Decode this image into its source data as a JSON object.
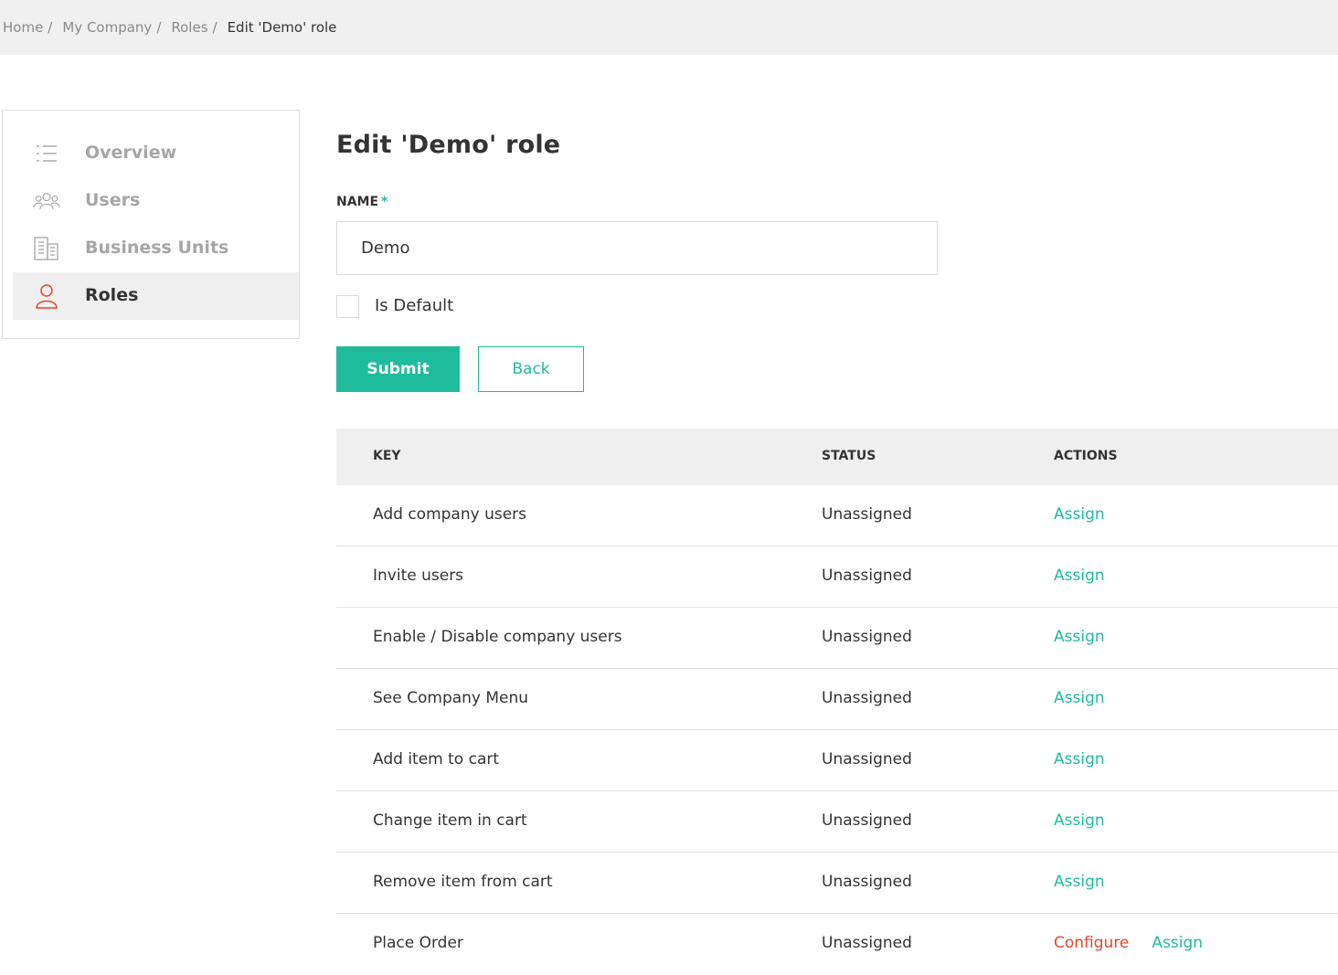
{
  "breadcrumb": {
    "items": [
      "Home",
      "My Company",
      "Roles"
    ],
    "separator": "/",
    "current": "Edit 'Demo' role"
  },
  "sidebar": {
    "items": [
      {
        "label": "Overview",
        "icon": "list-icon",
        "active": false
      },
      {
        "label": "Users",
        "icon": "users-icon",
        "active": false
      },
      {
        "label": "Business Units",
        "icon": "building-icon",
        "active": false
      },
      {
        "label": "Roles",
        "icon": "user-icon",
        "active": true
      }
    ]
  },
  "form": {
    "title": "Edit 'Demo' role",
    "name_label": "NAME",
    "required_mark": "*",
    "name_value": "Demo",
    "is_default_label": "Is Default",
    "is_default_checked": false,
    "submit_label": "Submit",
    "back_label": "Back"
  },
  "table": {
    "headers": {
      "key": "KEY",
      "status": "STATUS",
      "actions": "ACTIONS"
    },
    "rows": [
      {
        "key": "Add company users",
        "status": "Unassigned",
        "configure": "",
        "assign": "Assign"
      },
      {
        "key": "Invite users",
        "status": "Unassigned",
        "configure": "",
        "assign": "Assign"
      },
      {
        "key": "Enable / Disable company users",
        "status": "Unassigned",
        "configure": "",
        "assign": "Assign"
      },
      {
        "key": "See Company Menu",
        "status": "Unassigned",
        "configure": "",
        "assign": "Assign"
      },
      {
        "key": "Add item to cart",
        "status": "Unassigned",
        "configure": "",
        "assign": "Assign"
      },
      {
        "key": "Change item in cart",
        "status": "Unassigned",
        "configure": "",
        "assign": "Assign"
      },
      {
        "key": "Remove item from cart",
        "status": "Unassigned",
        "configure": "",
        "assign": "Assign"
      },
      {
        "key": "Place Order",
        "status": "Unassigned",
        "configure": "Configure",
        "assign": "Assign"
      }
    ]
  },
  "colors": {
    "accent": "#1fbc9c",
    "danger": "#e5452b",
    "breadcrumb_bg": "#f0f0f0",
    "active_bg": "#efefef"
  }
}
